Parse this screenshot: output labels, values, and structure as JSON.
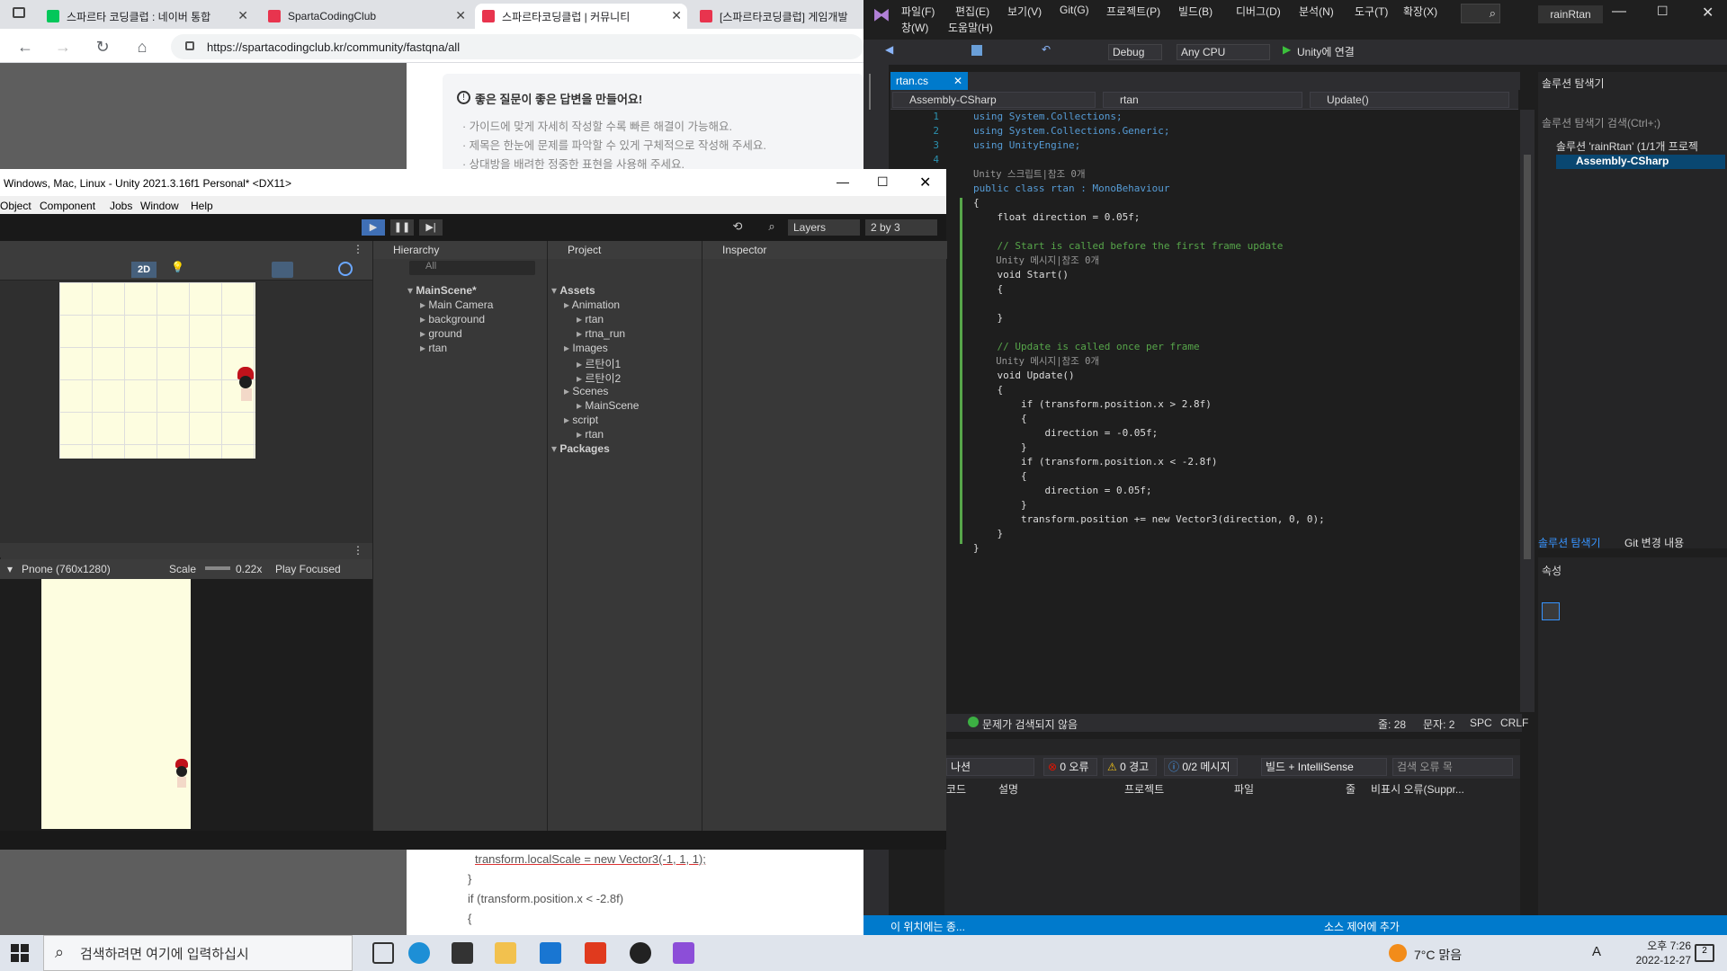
{
  "browser": {
    "tabs": [
      {
        "label": "스파르타 코딩클럽 : 네이버 통합",
        "color": "#03c75a",
        "icon": "N"
      },
      {
        "label": "SpartaCodingClub",
        "color": "#e8344e",
        "icon": "S"
      },
      {
        "label": "스파르타코딩클럽 | 커뮤니티",
        "color": "#e8344e",
        "icon": "S"
      },
      {
        "label": "[스파르타코딩클럽] 게임개발",
        "color": "#e8344e",
        "icon": "S"
      }
    ],
    "url": "https://spartacodingclub.kr/community/fastqna/all",
    "guide_title": "좋은 질문이 좋은 답변을 만들어요!",
    "guide_lines": [
      "· 가이드에 맞게 자세히 작성할 수록 빠른 해결이 가능해요.",
      "· 제목은 한눈에 문제를 파악할 수 있게 구체적으로 작성해 주세요.",
      "· 상대방을 배려한 정중한 표현을 사용해 주세요."
    ],
    "code_below": [
      "transform.localScale = new Vector3(-1, 1, 1);",
      "}",
      "if (transform.position.x < -2.8f)",
      "{"
    ]
  },
  "vs": {
    "menu": [
      "파일(F)",
      "편집(E)",
      "보기(V)",
      "Git(G)",
      "프로젝트(P)",
      "빌드(B)",
      "디버그(D)",
      "분석(N)",
      "도구(T)",
      "확장(X)",
      "창(W)",
      "도움말(H)"
    ],
    "project_name": "rainRtan",
    "config": "Debug",
    "platform": "Any CPU",
    "attach": "Unity에 연결",
    "tab_name": "rtan.cs",
    "nav": [
      "Assembly-CSharp",
      "rtan",
      "Update()"
    ],
    "code_lines": [
      {
        "n": "1",
        "t": "using System.Collections;"
      },
      {
        "n": "2",
        "t": "using System.Collections.Generic;"
      },
      {
        "n": "3",
        "t": "using UnityEngine;"
      },
      {
        "n": "4",
        "t": ""
      },
      {
        "n": "",
        "t": "Unity 스크립트|참조 0개"
      },
      {
        "n": "5",
        "t": "public class rtan : MonoBehaviour"
      },
      {
        "n": "6",
        "t": "{"
      },
      {
        "n": "7",
        "t": "    float direction = 0.05f;"
      },
      {
        "n": "8",
        "t": ""
      },
      {
        "n": "9",
        "t": "    // Start is called before the first frame update"
      },
      {
        "n": "",
        "t": "    Unity 메시지|참조 0개"
      },
      {
        "n": "10",
        "t": "    void Start()"
      },
      {
        "n": "11",
        "t": "    {"
      },
      {
        "n": "12",
        "t": ""
      },
      {
        "n": "13",
        "t": "    }"
      },
      {
        "n": "14",
        "t": ""
      },
      {
        "n": "15",
        "t": "    // Update is called once per frame"
      },
      {
        "n": "",
        "t": "    Unity 메시지|참조 0개"
      },
      {
        "n": "16",
        "t": "    void Update()"
      },
      {
        "n": "17",
        "t": "    {"
      },
      {
        "n": "18",
        "t": "        if (transform.position.x > 2.8f)"
      },
      {
        "n": "19",
        "t": "        {"
      },
      {
        "n": "20",
        "t": "            direction = -0.05f;"
      },
      {
        "n": "21",
        "t": "        }"
      },
      {
        "n": "22",
        "t": "        if (transform.position.x < -2.8f)"
      },
      {
        "n": "23",
        "t": "        {"
      },
      {
        "n": "24",
        "t": "            direction = 0.05f;"
      },
      {
        "n": "25",
        "t": "        }"
      },
      {
        "n": "26",
        "t": "        transform.position += new Vector3(direction, 0, 0);"
      },
      {
        "n": "27",
        "t": "    }"
      },
      {
        "n": "28",
        "t": "}"
      }
    ],
    "status_issues": "문제가 검색되지 않음",
    "status_line": "줄: 28",
    "status_char": "문자: 2",
    "status_spc": "SPC",
    "status_crlf": "CRLF",
    "err_errors": "0 오류",
    "err_warnings": "0 경고",
    "err_messages": "0/2 메시지",
    "err_scope": "빌드 + IntelliSense",
    "err_search": "검색 오류 목",
    "err_cols": [
      "코드",
      "설명",
      "프로젝트",
      "파일",
      "줄",
      "비표시 오류(Suppr..."
    ],
    "err_scope_partial": "나션",
    "solex_title": "솔루션 탐색기",
    "solex_search": "솔루션 탐색기 검색(Ctrl+;)",
    "solex_items": [
      "솔루션 'rainRtan' (1/1개 프로젝",
      "Assembly-CSharp"
    ],
    "solex_tabs": [
      "솔루션 탐색기",
      "Git 변경 내용"
    ],
    "props_title": "속성",
    "bottom_status": "이 위치에는 종...",
    "bottom_right": "소스 제어에 추가"
  },
  "unity": {
    "title": "Windows, Mac, Linux - Unity 2021.3.16f1 Personal* <DX11>",
    "menu": [
      "Object",
      "Component",
      "Jobs",
      "Window",
      "Help"
    ],
    "layers": "Layers",
    "layout": "2 by 3",
    "hierarchy_title": "Hierarchy",
    "hierarchy_search": "All",
    "hierarchy_items": [
      {
        "label": "MainScene*",
        "indent": 0
      },
      {
        "label": "Main Camera",
        "indent": 1
      },
      {
        "label": "background",
        "indent": 1
      },
      {
        "label": "ground",
        "indent": 1
      },
      {
        "label": "rtan",
        "indent": 1
      }
    ],
    "project_title": "Project",
    "project_items": [
      {
        "label": "Assets",
        "indent": 0
      },
      {
        "label": "Animation",
        "indent": 1
      },
      {
        "label": "rtan",
        "indent": 2
      },
      {
        "label": "rtna_run",
        "indent": 2
      },
      {
        "label": "Images",
        "indent": 1
      },
      {
        "label": "르탄이1",
        "indent": 2
      },
      {
        "label": "르탄이2",
        "indent": 2
      },
      {
        "label": "Scenes",
        "indent": 1
      },
      {
        "label": "MainScene",
        "indent": 2
      },
      {
        "label": "script",
        "indent": 1
      },
      {
        "label": "rtan",
        "indent": 2
      },
      {
        "label": "Packages",
        "indent": 0
      }
    ],
    "inspector_title": "Inspector",
    "mode_2d": "2D",
    "game_resolution": "Pnone (760x1280)",
    "game_scale_label": "Scale",
    "game_scale": "0.22x",
    "game_play_mode": "Play Focused"
  },
  "taskbar": {
    "search_placeholder": "검색하려면 여기에 입력하십시",
    "weather": "7°C 맑음",
    "time": "오후 7:26",
    "date": "2022-12-27",
    "ime": "A",
    "notifications": "2"
  }
}
